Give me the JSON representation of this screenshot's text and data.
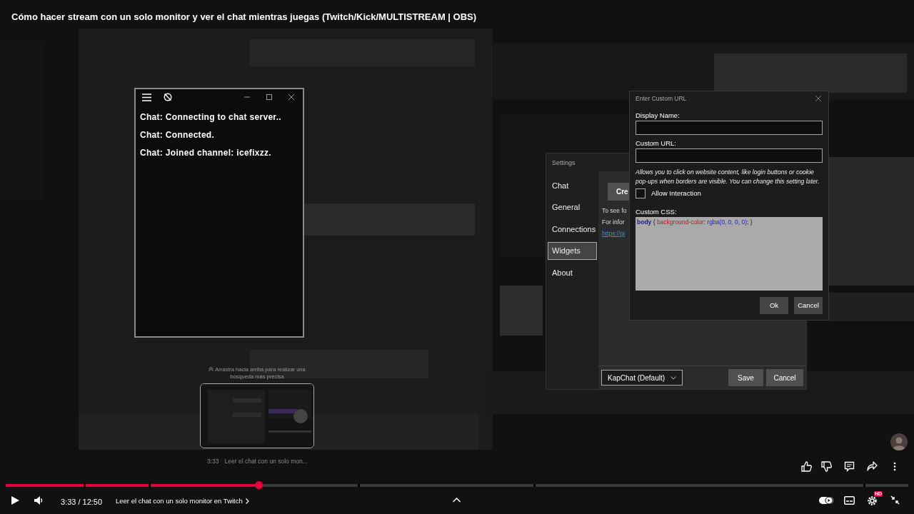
{
  "video": {
    "title": "Cómo hacer stream con un solo monitor y ver el chat mientras juegas (Twitch/Kick/MULTISTREAM | OBS)",
    "kind": "picture"
  },
  "chat_window": {
    "lines": [
      "Chat: Connecting to chat server..",
      "Chat: Connected.",
      "Chat: Joined channel: icefixzz."
    ]
  },
  "settings": {
    "title": "Settings",
    "nav": [
      {
        "label": "Chat",
        "selected": false
      },
      {
        "label": "General",
        "selected": false
      },
      {
        "label": "Connections",
        "selected": false
      },
      {
        "label": "Widgets",
        "selected": true
      },
      {
        "label": "About",
        "selected": false
      }
    ],
    "create_button": "Cre",
    "texts": [
      "To see fo",
      "For infor"
    ],
    "link": "https://gi",
    "widget_select": "KapChat (Default)",
    "buttons": [
      "Save",
      "Cancel"
    ]
  },
  "custom_url_dialog": {
    "title": "Enter Custom URL",
    "display_name_label": "Display Name:",
    "custom_url_label": "Custom URL:",
    "note": "Allows you to click on website content, like login buttons or cookie pop-ups when borders are visible. You can change this setting later.",
    "allow_interaction": {
      "label": "Allow Interaction",
      "checked": false
    },
    "css_label": "Custom CSS:",
    "css": [
      {
        "text": "body",
        "kind": "selector"
      },
      {
        "text": " { ",
        "kind": "plain"
      },
      {
        "text": "background-color",
        "kind": "property"
      },
      {
        "text": ": ",
        "kind": "plain"
      },
      {
        "text": "rgba(0, 0, 0, 0)",
        "kind": "value"
      },
      {
        "text": "; }",
        "kind": "plain"
      }
    ],
    "buttons": [
      "Ok",
      "Cancel"
    ]
  },
  "seek_preview": {
    "hint": "Arrastra hacia arriba para realizar una búsqueda más precisa",
    "time": "3:33",
    "chapter": "Leer el chat con un solo mon..."
  },
  "player": {
    "level": 0.28,
    "time": "3:33 / 12:50",
    "chapter": "Leer el chat con un solo monitor en Twitch",
    "autoplay": {
      "on": true
    },
    "quality_badge": "HD"
  }
}
